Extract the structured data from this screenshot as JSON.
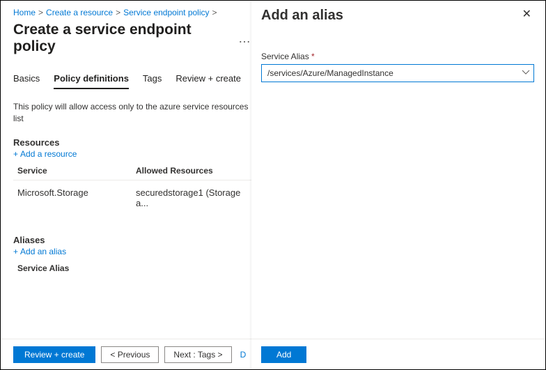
{
  "breadcrumb": {
    "items": [
      {
        "label": "Home"
      },
      {
        "label": "Create a resource"
      },
      {
        "label": "Service endpoint policy"
      }
    ]
  },
  "page": {
    "title": "Create a service endpoint policy",
    "ellipsis": "…"
  },
  "tabs": {
    "items": [
      {
        "label": "Basics"
      },
      {
        "label": "Policy definitions"
      },
      {
        "label": "Tags"
      },
      {
        "label": "Review + create"
      }
    ]
  },
  "description": "This policy will allow access only to the azure service resources list",
  "resources": {
    "heading": "Resources",
    "add_label": "Add a resource",
    "columns": {
      "service": "Service",
      "allowed": "Allowed Resources"
    },
    "rows": [
      {
        "service": "Microsoft.Storage",
        "allowed": "securedstorage1 (Storage a..."
      }
    ]
  },
  "aliases": {
    "heading": "Aliases",
    "add_label": "Add an alias",
    "column": "Service Alias"
  },
  "footer": {
    "review": "Review + create",
    "previous": "< Previous",
    "next": "Next : Tags >",
    "trailing": "D"
  },
  "panel": {
    "title": "Add an alias",
    "field_label": "Service Alias",
    "selected_value": "/services/Azure/ManagedInstance",
    "add_button": "Add"
  }
}
